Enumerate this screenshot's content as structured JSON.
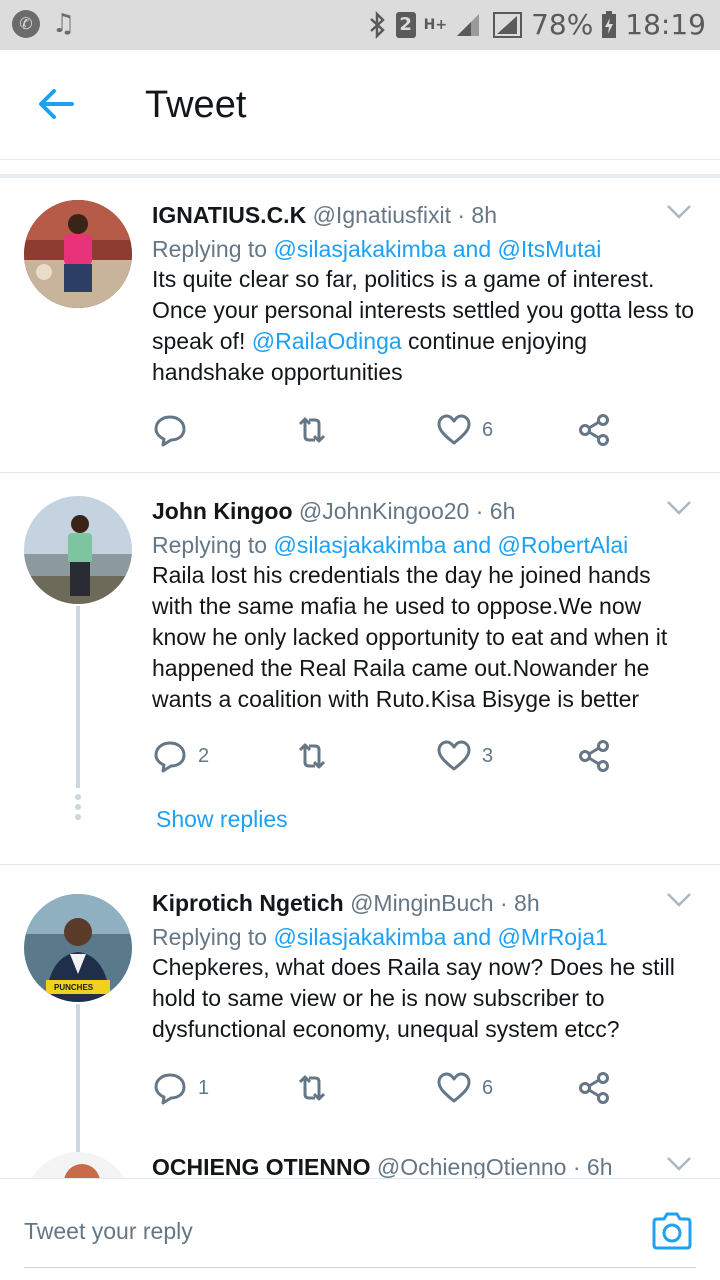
{
  "status_bar": {
    "sim_badge": "2",
    "network": "H+",
    "battery": "78%",
    "time": "18:19",
    "left_icons": [
      "whatsapp-icon",
      "music-note-icon"
    ]
  },
  "app_bar": {
    "title": "Tweet",
    "back_icon": "arrow-left-icon"
  },
  "tweets": [
    {
      "name": "IGNATIUS.C.K",
      "handle": "@Ignatiusfixit · 8h",
      "replying_prefix": "Replying to",
      "replying_to": "@silasjakakimba and @ItsMutai",
      "text_before": "Its quite clear so far, politics is a game of interest. Once your personal interests settled you gotta less to speak of! ",
      "mention": "@RailaOdinga",
      "text_after": " continue enjoying handshake opportunities",
      "replies": "",
      "retweets": "",
      "likes": "6"
    },
    {
      "name": "John Kingoo",
      "handle": "@JohnKingoo20 · 6h",
      "replying_prefix": "Replying to",
      "replying_to": "@silasjakakimba and @RobertAlai",
      "text": "Raila lost his credentials the day he joined hands with the same mafia he used to oppose.We now know he only lacked opportunity to eat and when it happened the Real Raila came out.Nowander he wants a coalition with Ruto.Kisa Bisyge is better",
      "replies": "2",
      "retweets": "",
      "likes": "3",
      "show_replies": "Show replies"
    },
    {
      "name": "Kiprotich Ngetich",
      "handle": "@MinginBuch · 8h",
      "replying_prefix": "Replying to",
      "replying_to": "@silasjakakimba and @MrRoja1",
      "text": "Chepkeres, what does Raila say now? Does he still hold to same view or he is now subscriber to dysfunctional economy, unequal system etcc?",
      "replies": "1",
      "retweets": "",
      "likes": "6",
      "avatar_badge": "PUNCHES"
    },
    {
      "name": "OCHIENG OTIENNO",
      "handle": "@OchiengOtienno · 6h"
    }
  ],
  "compose": {
    "placeholder": "Tweet your reply",
    "camera_icon": "camera-icon"
  },
  "colors": {
    "accent": "#1da1f2",
    "secondary_text": "#657786",
    "status_bar_bg": "#dcdcdc"
  }
}
